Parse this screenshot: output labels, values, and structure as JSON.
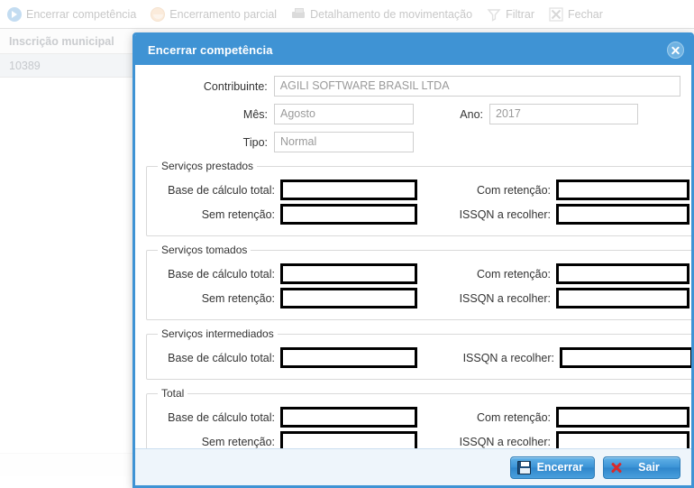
{
  "toolbar": {
    "items": [
      {
        "label": "Encerrar competência",
        "icon": "arrow-circle-right-icon"
      },
      {
        "label": "Encerramento parcial",
        "icon": "partial-circle-icon"
      },
      {
        "label": "Detalhamento de movimentação",
        "icon": "printer-icon"
      },
      {
        "label": "Filtrar",
        "icon": "funnel-icon"
      },
      {
        "label": "Fechar",
        "icon": "close-x-icon"
      }
    ]
  },
  "grid": {
    "column_header": "Inscrição municipal",
    "rows": [
      "10389"
    ]
  },
  "dialog": {
    "title": "Encerrar competência",
    "close_icon": "close-circle-icon",
    "header_color": "#3f93d4",
    "fields": {
      "contribuinte_label": "Contribuinte:",
      "contribuinte_value": "AGILI SOFTWARE BRASIL LTDA",
      "mes_label": "Mês:",
      "mes_value": "Agosto",
      "ano_label": "Ano:",
      "ano_value": "2017",
      "tipo_label": "Tipo:",
      "tipo_value": "Normal"
    },
    "sections": [
      {
        "legend": "Serviços prestados",
        "rows": [
          {
            "left_label": "Base de cálculo total:",
            "left_value": "",
            "right_label": "Com retenção:",
            "right_value": ""
          },
          {
            "left_label": "Sem retenção:",
            "left_value": "",
            "right_label": "ISSQN a recolher:",
            "right_value": ""
          }
        ]
      },
      {
        "legend": "Serviços tomados",
        "rows": [
          {
            "left_label": "Base de cálculo total:",
            "left_value": "",
            "right_label": "Com retenção:",
            "right_value": ""
          },
          {
            "left_label": "Sem retenção:",
            "left_value": "",
            "right_label": "ISSQN a recolher:",
            "right_value": ""
          }
        ]
      },
      {
        "legend": "Serviços intermediados",
        "rows": [
          {
            "left_label": "Base de cálculo total:",
            "left_value": "",
            "right_label": "ISSQN a recolher:",
            "right_value": ""
          }
        ]
      },
      {
        "legend": "Total",
        "rows": [
          {
            "left_label": "Base de cálculo total:",
            "left_value": "",
            "right_label": "Com retenção:",
            "right_value": ""
          },
          {
            "left_label": "Sem retenção:",
            "left_value": "",
            "right_label": "ISSQN a recolher:",
            "right_value": ""
          }
        ]
      }
    ],
    "buttons": {
      "save_label": "Encerrar",
      "save_icon": "floppy-save-icon",
      "exit_label": "Sair",
      "exit_icon": "red-x-icon"
    }
  }
}
